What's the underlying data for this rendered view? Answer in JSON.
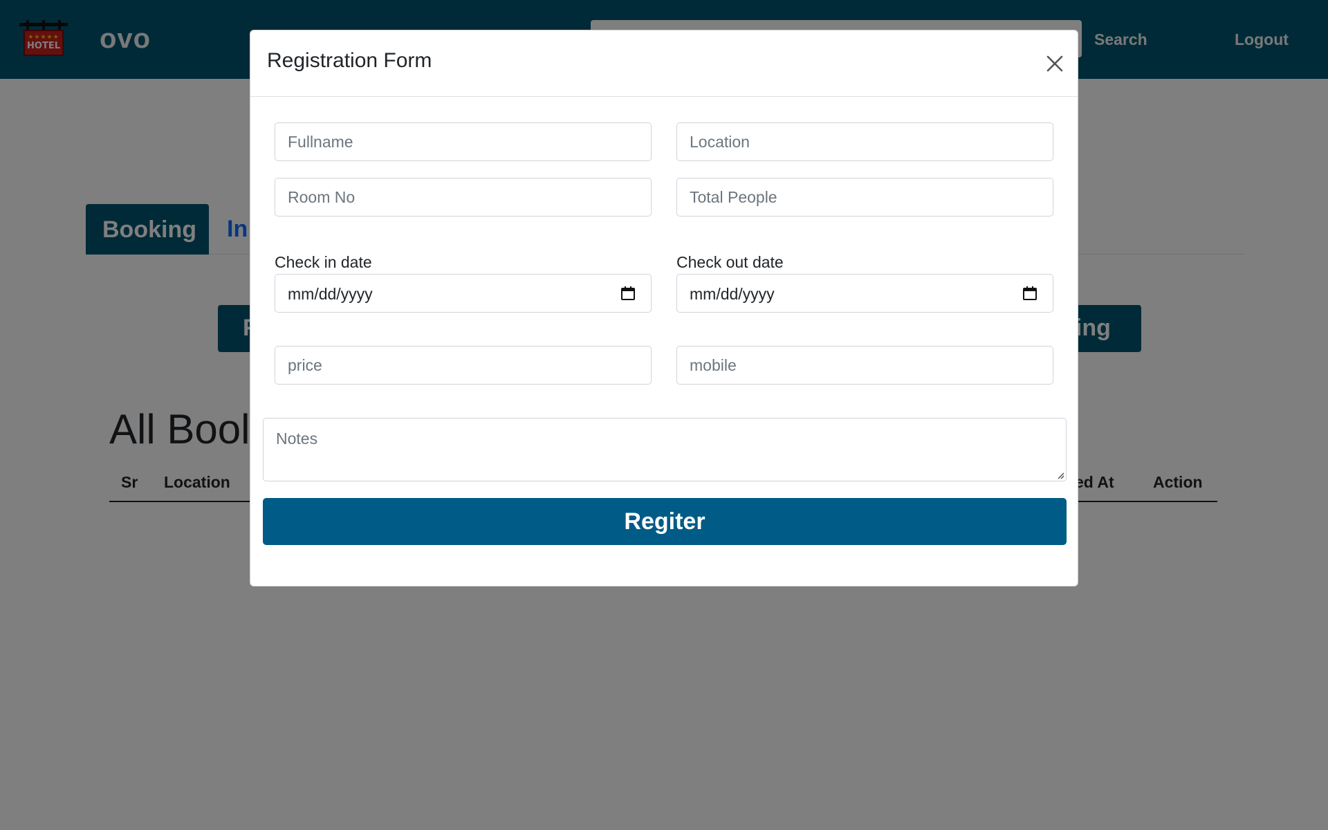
{
  "navbar": {
    "logo_text": "HOTEL",
    "logo_stars": "★★★★★",
    "brand": "ovo",
    "search_label": "Search",
    "logout_label": "Logout"
  },
  "tabs": [
    {
      "label": "Booking",
      "active": true
    },
    {
      "label": "In",
      "active": false
    }
  ],
  "actions": {
    "left_label": "F",
    "right_label": "king"
  },
  "list": {
    "title": "All Bool",
    "columns": [
      "Sr",
      "Location",
      "ed At",
      "Action"
    ]
  },
  "modal": {
    "title": "Registration Form",
    "fields": {
      "fullname_placeholder": "Fullname",
      "location_placeholder": "Location",
      "room_placeholder": "Room No",
      "people_placeholder": "Total People",
      "checkin_label": "Check in date",
      "checkin_value": "mm/dd/yyyy",
      "checkout_label": "Check out date",
      "checkout_value": "mm/dd/yyyy",
      "price_placeholder": "price",
      "mobile_placeholder": "mobile",
      "notes_placeholder": "Notes"
    },
    "submit_label": "Regiter"
  },
  "colors": {
    "navbar": "#00546f",
    "primary_button": "#005b87",
    "link": "#0d6efd",
    "backdrop": "rgba(0,0,0,0.5)"
  },
  "icons": [
    "hotel-logo-icon",
    "close-icon",
    "calendar-icon",
    "resize-grip-icon"
  ]
}
